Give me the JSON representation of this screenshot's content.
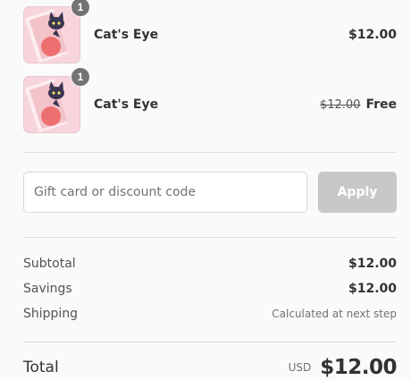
{
  "items": [
    {
      "quantity": "1",
      "name": "Cat's Eye",
      "price": "$12.00"
    },
    {
      "quantity": "1",
      "name": "Cat's Eye",
      "original_price": "$12.00",
      "price": "Free"
    }
  ],
  "discount": {
    "placeholder": "Gift card or discount code",
    "apply_label": "Apply"
  },
  "summary": {
    "subtotal_label": "Subtotal",
    "subtotal_value": "$12.00",
    "savings_label": "Savings",
    "savings_value": "$12.00",
    "shipping_label": "Shipping",
    "shipping_value": "Calculated at next step"
  },
  "total": {
    "label": "Total",
    "currency": "USD",
    "amount": "$12.00"
  },
  "colors": {
    "thumb_bg": "#f8d5dc",
    "badge": "#737373",
    "apply_disabled": "#c8c8c8"
  },
  "icons": {
    "product_image": "cat-eye-product-image"
  }
}
